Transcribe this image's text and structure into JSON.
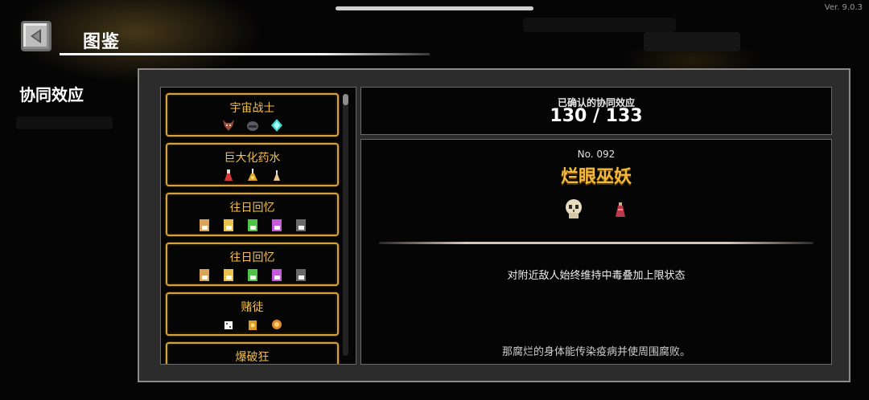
{
  "version": "Ver. 9.0.3",
  "header": {
    "title": "图鉴"
  },
  "side_nav": {
    "active_label": "协同效应"
  },
  "list": {
    "items": [
      {
        "name": "宇宙战士",
        "icons": [
          "demon-mask-icon",
          "dark-helmet-icon",
          "cyan-crystal-icon"
        ]
      },
      {
        "name": "巨大化药水",
        "icons": [
          "red-potion-icon",
          "gold-potion-icon",
          "small-flask-icon"
        ]
      },
      {
        "name": "往日回忆",
        "icons": [
          "tan-card-icon",
          "yellow-card-icon",
          "green-card-icon",
          "purple-card-icon",
          "gray-card-icon"
        ]
      },
      {
        "name": "往日回忆",
        "icons": [
          "tan-card-icon",
          "yellow-card-icon",
          "green-card-icon",
          "purple-card-icon",
          "gray-card-icon"
        ]
      },
      {
        "name": "赌徒",
        "icons": [
          "dice-icon",
          "coin-bag-icon",
          "orange-chip-icon"
        ]
      },
      {
        "name": "爆破狂",
        "icons": []
      }
    ]
  },
  "summary": {
    "label": "已确认的协同效应",
    "value": "130 / 133"
  },
  "detail": {
    "number": "No. 092",
    "name": "烂眼巫妖",
    "icons": [
      "skull-icon",
      "red-robe-icon"
    ],
    "effect": "对附近敌人始终维持中毒叠加上限状态",
    "flavor": "那腐烂的身体能传染疫病并使周围腐败。"
  },
  "colors": {
    "accent": "#f3b93a",
    "item_border": "#d7a13b",
    "panel": "#2c2c2c"
  }
}
